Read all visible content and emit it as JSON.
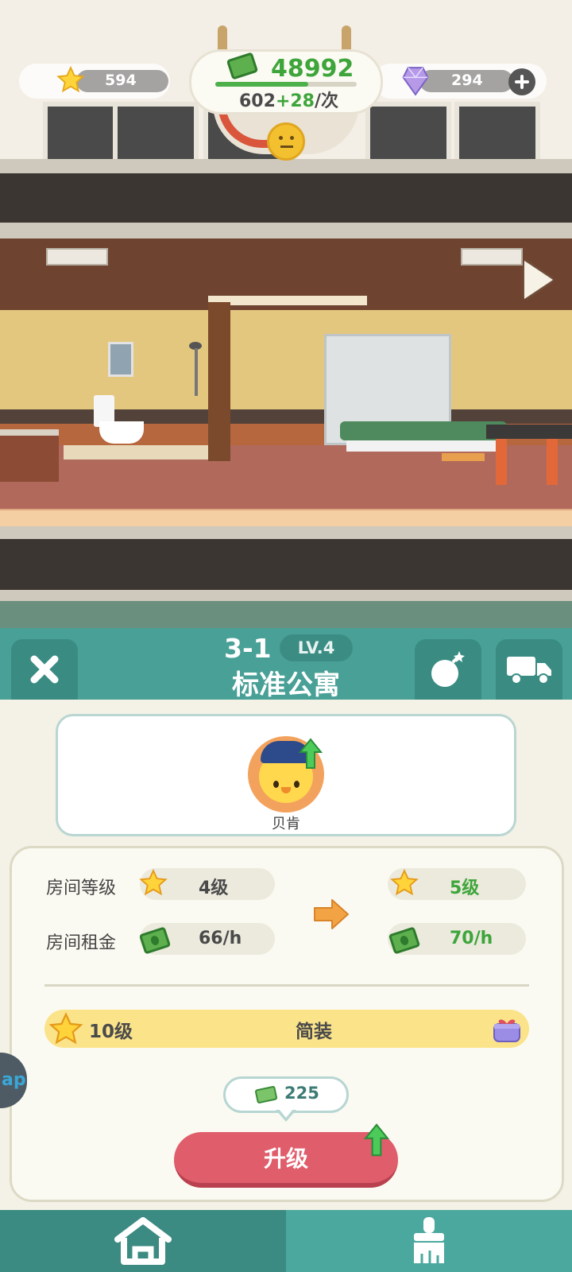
{
  "hud": {
    "stars": "594",
    "cash": "48992",
    "rent_base": "602",
    "rent_bonus": "+28",
    "rent_unit": "/次",
    "gems": "294"
  },
  "panel": {
    "room_id": "3-1",
    "level_badge": "LV.4",
    "room_name": "标准公寓"
  },
  "tenant": {
    "name": "贝肯"
  },
  "stats": {
    "room_level_label": "房间等级",
    "room_level_current": "4级",
    "room_level_next": "5级",
    "room_rent_label": "房间租金",
    "room_rent_current": "66/h",
    "room_rent_next": "70/h"
  },
  "decor": {
    "level": "10级",
    "style": "简装"
  },
  "upgrade": {
    "cost": "225",
    "label": "升级"
  },
  "side_tab": {
    "label": "ap"
  },
  "colors": {
    "teal": "#48a096",
    "upgrade_red": "#e05d6b",
    "green_text": "#3ea53b",
    "decor_yellow": "#fbe38a"
  },
  "icons": [
    "star-icon",
    "cash-icon",
    "gem-icon",
    "plus-icon",
    "close-icon",
    "bomb-icon",
    "truck-icon",
    "gift-icon",
    "home-icon",
    "paint-brush-icon",
    "arrow-up-icon",
    "arrow-right-icon"
  ]
}
